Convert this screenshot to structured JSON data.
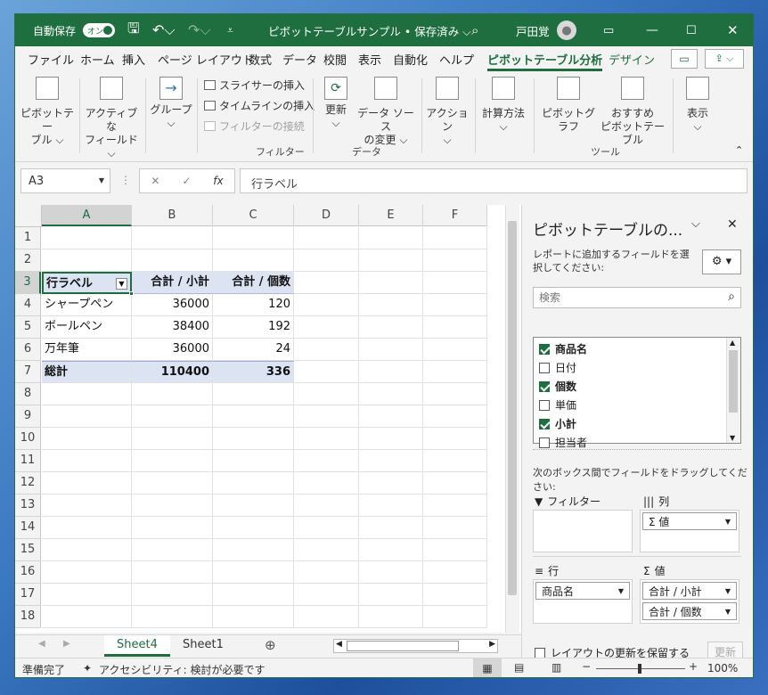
{
  "titlebar": {
    "autosave_label": "自動保存",
    "autosave_state": "オン",
    "doc_title": "ピボットテーブルサンプル • 保存済み ⌵",
    "user": "戸田覚"
  },
  "tabs": [
    "ファイル",
    "ホーム",
    "挿入",
    "ページ レイアウト",
    "数式",
    "データ",
    "校閲",
    "表示",
    "自動化",
    "ヘルプ",
    "ピボットテーブル分析",
    "デザイン"
  ],
  "ribbon": {
    "pivottable": [
      "ピボットテー",
      "ブル ⌵"
    ],
    "active_field": [
      "アクティブな",
      "フィールド ⌵"
    ],
    "group": [
      "グループ",
      "⌵"
    ],
    "insert_slicer": "スライサーの挿入",
    "insert_timeline": "タイムラインの挿入",
    "filter_connections": "フィルターの接続",
    "filter_group": "フィルター",
    "refresh": [
      "更新",
      "⌵"
    ],
    "change_source": [
      "データ ソース",
      "の変更 ⌵"
    ],
    "data_group": "データ",
    "actions": [
      "アクション",
      "⌵"
    ],
    "calculations": [
      "計算方法",
      "⌵"
    ],
    "pivotchart": "ピボットグラフ",
    "recommended": [
      "おすすめ",
      "ピボットテーブル"
    ],
    "tools_group": "ツール",
    "show": [
      "表示",
      "⌵"
    ]
  },
  "formula": {
    "namebox": "A3",
    "content": "行ラベル",
    "fx": "fx"
  },
  "columns": [
    "A",
    "B",
    "C",
    "D",
    "E",
    "F"
  ],
  "rows": [
    "1",
    "2",
    "3",
    "4",
    "5",
    "6",
    "7",
    "8",
    "9",
    "10",
    "11",
    "12",
    "13",
    "14",
    "15",
    "16",
    "17",
    "18"
  ],
  "pivot": {
    "headers": [
      "行ラベル",
      "合計 / 小計",
      "合計 / 個数"
    ],
    "data": [
      [
        "シャープペン",
        "36000",
        "120"
      ],
      [
        "ボールペン",
        "38400",
        "192"
      ],
      [
        "万年筆",
        "36000",
        "24"
      ]
    ],
    "total": [
      "総計",
      "110400",
      "336"
    ]
  },
  "sheets": [
    "Sheet4",
    "Sheet1"
  ],
  "status": {
    "ready": "準備完了",
    "accessibility": "アクセシビリティ: 検討が必要です",
    "zoom": "100%"
  },
  "pane": {
    "title": "ピボットテーブルの...",
    "instruction": "レポートに追加するフィールドを選択してください:",
    "search_placeholder": "検索",
    "fields": [
      {
        "name": "商品名",
        "checked": true
      },
      {
        "name": "日付",
        "checked": false
      },
      {
        "name": "個数",
        "checked": true
      },
      {
        "name": "単価",
        "checked": false
      },
      {
        "name": "小計",
        "checked": true
      },
      {
        "name": "担当者",
        "checked": false
      }
    ],
    "drag_hint": "次のボックス間でフィールドをドラッグしてください:",
    "filters_label": "フィルター",
    "columns_label": "列",
    "rows_label": "行",
    "values_label": "値",
    "columns_item": "Σ 値",
    "rows_item": "商品名",
    "values_items": [
      "合計 / 小計",
      "合計 / 個数"
    ],
    "defer_label": "レイアウトの更新を保留する",
    "update_btn": "更新"
  }
}
